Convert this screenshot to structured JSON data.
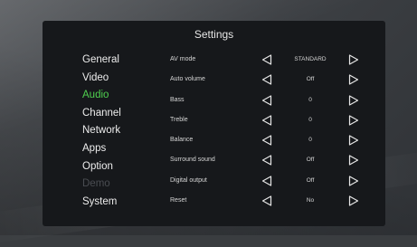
{
  "title": "Settings",
  "menu": [
    {
      "label": "General",
      "state": "normal"
    },
    {
      "label": "Video",
      "state": "normal"
    },
    {
      "label": "Audio",
      "state": "active"
    },
    {
      "label": "Channel",
      "state": "normal"
    },
    {
      "label": "Network",
      "state": "normal"
    },
    {
      "label": "Apps",
      "state": "normal"
    },
    {
      "label": "Option",
      "state": "normal"
    },
    {
      "label": "Demo",
      "state": "disabled"
    },
    {
      "label": "System",
      "state": "normal"
    }
  ],
  "settings": [
    {
      "label": "AV mode",
      "value": "STANDARD"
    },
    {
      "label": "Auto volume",
      "value": "Off"
    },
    {
      "label": "Bass",
      "value": "0"
    },
    {
      "label": "Treble",
      "value": "0"
    },
    {
      "label": "Balance",
      "value": "0"
    },
    {
      "label": "Surround sound",
      "value": "Off"
    },
    {
      "label": "Digital output",
      "value": "Off"
    },
    {
      "label": "Reset",
      "value": "No"
    }
  ],
  "colors": {
    "active": "#4fd04f",
    "disabled": "#4a4d52",
    "text": "#ededed",
    "panel": "#16181b"
  },
  "icons": {
    "decrease": "triangle-left-icon",
    "increase": "triangle-right-icon"
  }
}
